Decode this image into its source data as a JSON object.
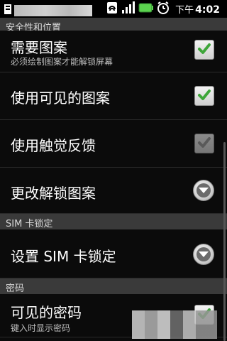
{
  "status_bar": {
    "time_prefix": "下午",
    "time": "4:02",
    "icons": [
      "sync-icon",
      "signal-icon",
      "battery-icon",
      "alarm-icon"
    ]
  },
  "top_section_label": "安全性和位置",
  "rows": [
    {
      "id": "require-pattern",
      "title": "需要图案",
      "subtitle": "必须绘制图案才能解锁屏幕",
      "control": "checkbox",
      "checked": true,
      "enabled": true
    },
    {
      "id": "visible-pattern",
      "title": "使用可见的图案",
      "control": "checkbox",
      "checked": true,
      "enabled": true
    },
    {
      "id": "tactile-feedback",
      "title": "使用触觉反馈",
      "control": "checkbox",
      "checked": true,
      "enabled": false
    },
    {
      "id": "change-unlock-pattern",
      "title": "更改解锁图案",
      "control": "chevron"
    }
  ],
  "sim_section": {
    "header": "SIM 卡锁定",
    "row": {
      "title": "设置 SIM 卡锁定",
      "control": "chevron"
    }
  },
  "password_section": {
    "header": "密码",
    "row": {
      "title": "可见的密码",
      "subtitle": "键入时显示密码",
      "control": "checkbox",
      "checked": true
    }
  },
  "colors": {
    "check_green": "#3ea63a",
    "section_header_bg": "#3a3a3a",
    "list_bg": "#0b0b0b"
  }
}
